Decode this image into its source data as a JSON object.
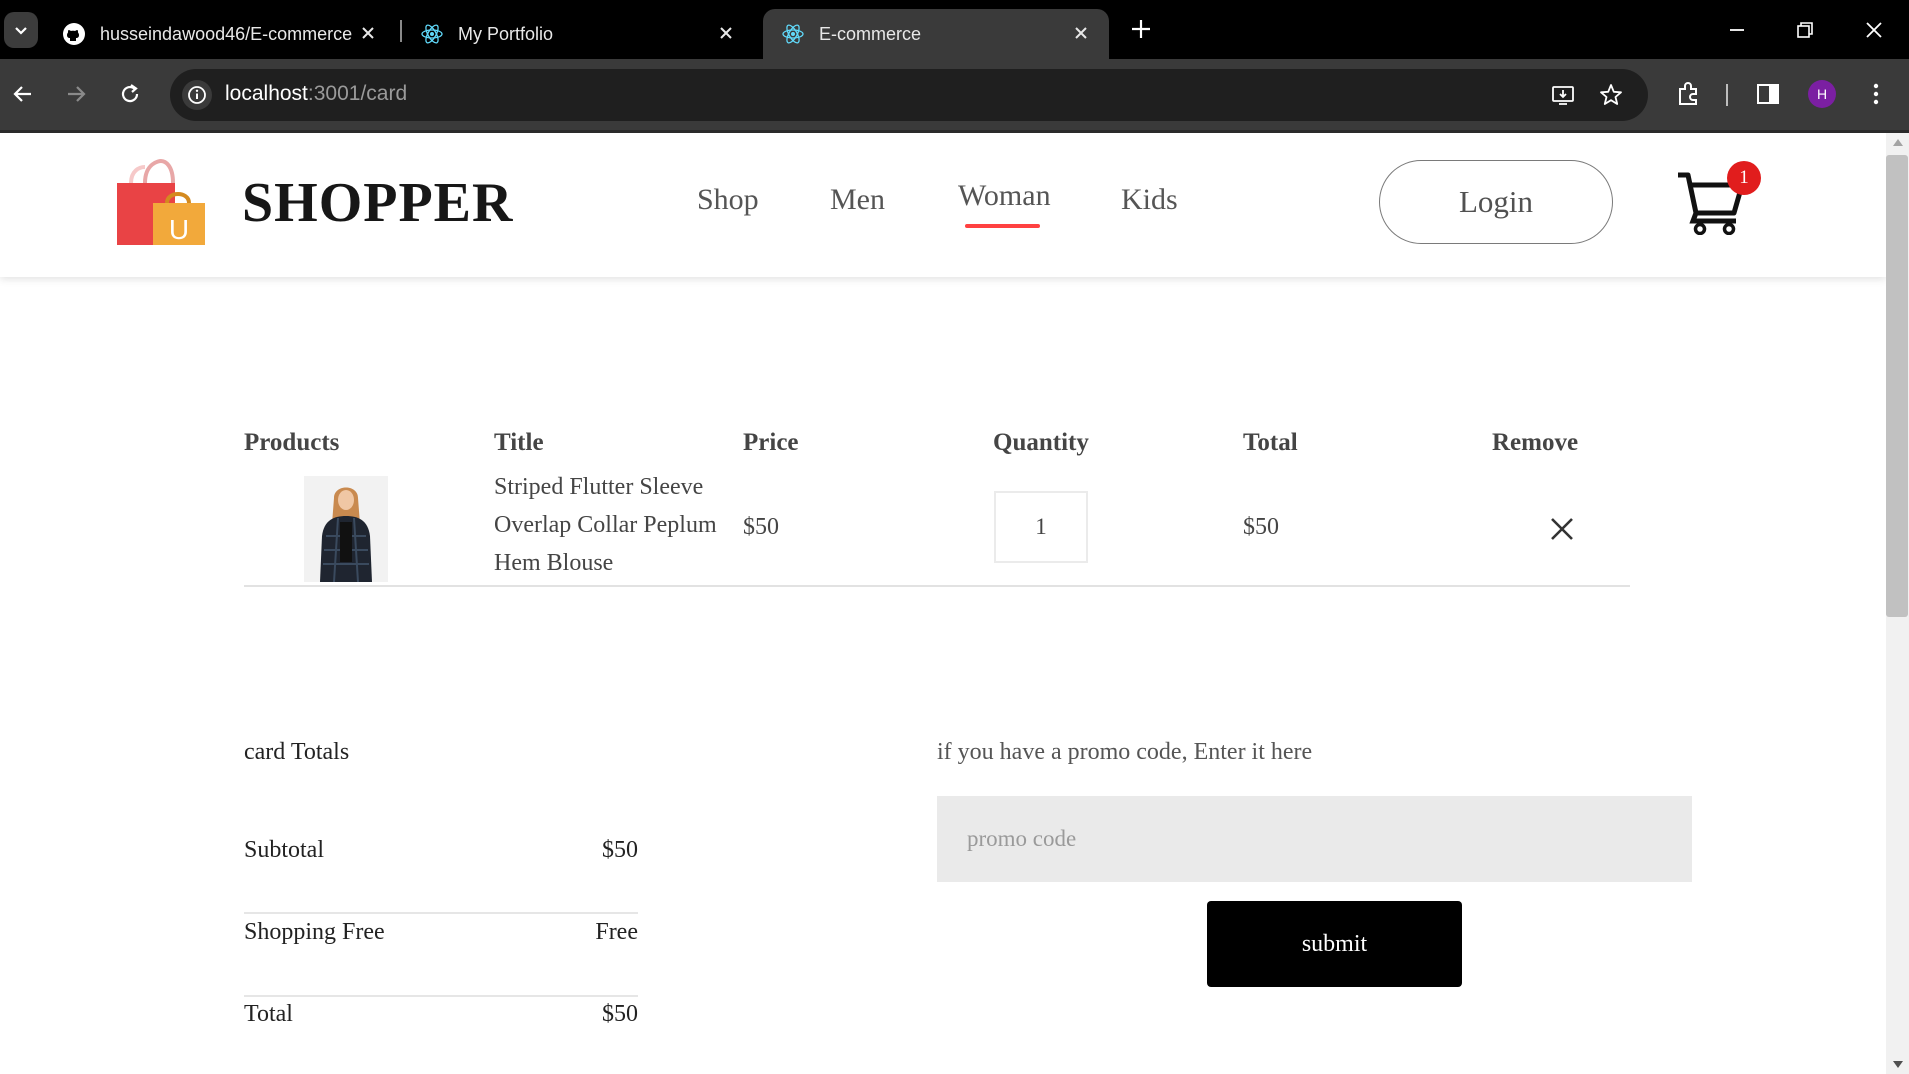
{
  "browser": {
    "tabs": [
      {
        "label": "husseindawood46/E-commerce",
        "favicon": "github-icon"
      },
      {
        "label": "My Portfolio",
        "favicon": "react-icon"
      },
      {
        "label": "E-commerce",
        "favicon": "react-icon",
        "active": true
      }
    ],
    "url": {
      "host": "localhost",
      "path": ":3001/card"
    },
    "profile_initial": "H",
    "profile_color": "#7b1fa2"
  },
  "site": {
    "brand": "SHOPPER",
    "menu": [
      {
        "label": "Shop"
      },
      {
        "label": "Men"
      },
      {
        "label": "Woman",
        "active": true
      },
      {
        "label": "Kids"
      }
    ],
    "login_label": "Login",
    "cart_count": "1",
    "accent_color": "#ff4141"
  },
  "cart": {
    "headers": [
      "Products",
      "Title",
      "Price",
      "Quantity",
      "Total",
      "Remove"
    ],
    "items": [
      {
        "image": "woman-in-dark-plaid-jacket",
        "title": "Striped Flutter Sleeve Overlap Collar Peplum Hem Blouse",
        "price": "$50",
        "quantity": "1",
        "total": "$50"
      }
    ]
  },
  "totals": {
    "title": "card Totals",
    "rows": [
      {
        "label": "Subtotal",
        "value": "$50"
      },
      {
        "label": "Shopping Free",
        "value": "Free"
      },
      {
        "label": "Total",
        "value": "$50"
      }
    ]
  },
  "promo": {
    "prompt": "if you have a promo code, Enter it here",
    "placeholder": "promo code",
    "submit_label": "submit"
  }
}
